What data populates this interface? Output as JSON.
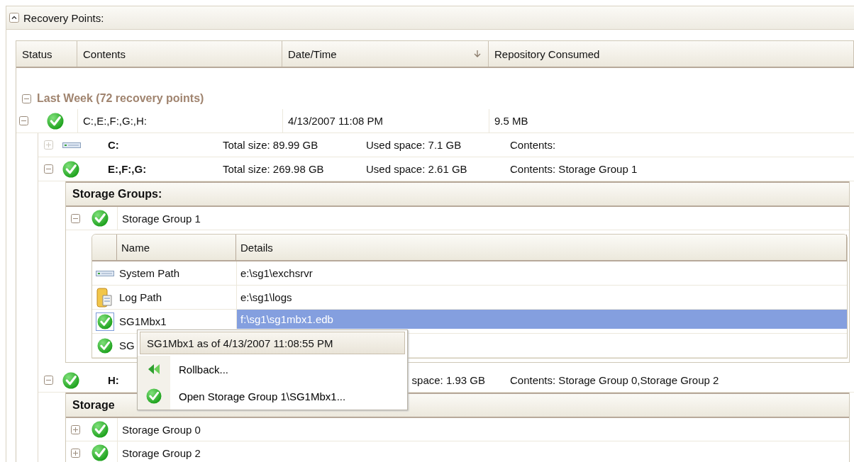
{
  "panel": {
    "title": "Recovery Points:",
    "expanded": true
  },
  "table": {
    "columns": [
      {
        "label": "Status",
        "sorted": false
      },
      {
        "label": "Contents",
        "sorted": false
      },
      {
        "label": "Date/Time",
        "sorted": true
      },
      {
        "label": "Repository Consumed",
        "sorted": false
      }
    ],
    "groups": [
      {
        "label": "Last Week (72 recovery points)",
        "expanded": true,
        "rows": [
          {
            "kind": "check",
            "expanded": true,
            "contents": "C:,E:,F:,G:,H:",
            "date_time": "4/13/2007 11:08 PM",
            "repository_consumed": "9.5 MB",
            "volumes": [
              {
                "kind": "drive",
                "expanded": false,
                "disabled": true,
                "name": "C:",
                "total_size": "Total size: 89.99 GB",
                "used_space": "Used space: 7.1 GB",
                "contents": "Contents:"
              },
              {
                "kind": "check",
                "expanded": true,
                "disabled": false,
                "name": "E:,F:,G:",
                "total_size": "Total size: 269.98 GB",
                "used_space": "Used space: 2.61 GB",
                "contents": "Contents: Storage Group 1",
                "storage_groups": {
                  "title": "Storage Groups:",
                  "groups": [
                    {
                      "kind": "check",
                      "expanded": true,
                      "name": "Storage Group 1",
                      "columns": [
                        "Name",
                        "Details"
                      ],
                      "items": [
                        {
                          "kind": "drive",
                          "name": "System Path",
                          "details": "e:\\sg1\\exchsrvr",
                          "selected": false
                        },
                        {
                          "kind": "log",
                          "name": "Log Path",
                          "details": "e:\\sg1\\logs",
                          "selected": false
                        },
                        {
                          "kind": "check",
                          "name": "SG1Mbx1",
                          "details": "f:\\sg1\\sg1mbx1.edb",
                          "selected": true
                        },
                        {
                          "kind": "check",
                          "name": "SG",
                          "selected": false
                        }
                      ]
                    }
                  ]
                }
              },
              {
                "kind": "check",
                "expanded": true,
                "disabled": false,
                "name": "H:",
                "used_space": "space: 1.93 GB",
                "contents": "Contents: Storage Group 0,Storage Group 2",
                "storage_groups": {
                  "title": "Storage",
                  "groups": [
                    {
                      "kind": "check",
                      "expanded": false,
                      "name": "Storage Group 0"
                    },
                    {
                      "kind": "check",
                      "expanded": false,
                      "name": "Storage Group 2"
                    }
                  ]
                }
              }
            ]
          }
        ]
      }
    ]
  },
  "context_menu": {
    "title": "SG1Mbx1 as of 4/13/2007 11:08:55 PM",
    "items": [
      {
        "kind": "rewind",
        "label": "Rollback..."
      },
      {
        "kind": "check",
        "label": "Open Storage Group 1\\SG1Mbx1..."
      }
    ]
  }
}
